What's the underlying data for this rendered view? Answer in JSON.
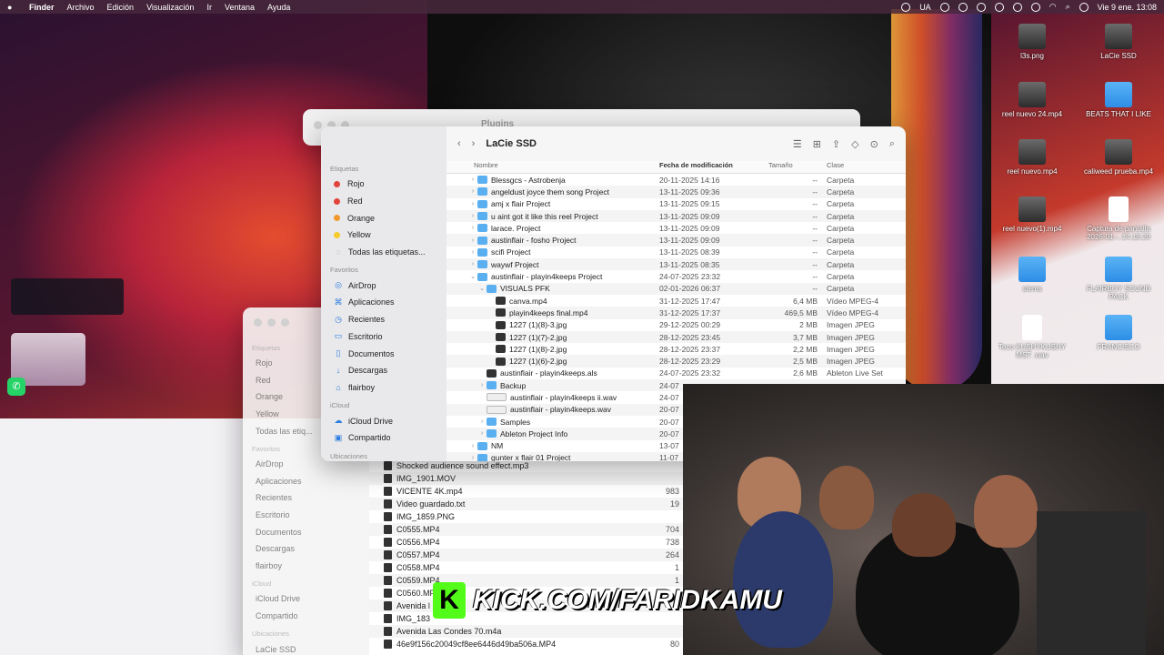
{
  "menubar": {
    "apple": "",
    "items": [
      "Finder",
      "Archivo",
      "Edición",
      "Visualización",
      "Ir",
      "Ventana",
      "Ayuda"
    ],
    "input_source": "UA",
    "datetime": "Vie 9 ene.  13:08"
  },
  "desktop_icons": [
    {
      "label": "l3s.png",
      "kind": "thumb"
    },
    {
      "label": "LaCie SSD",
      "kind": "drive"
    },
    {
      "label": "reel nuevo 24.mp4",
      "kind": "thumb"
    },
    {
      "label": "BEATS THAT I LIKE",
      "kind": "folder"
    },
    {
      "label": "reel nuevo.mp4",
      "kind": "thumb"
    },
    {
      "label": "caliweed prueba.mp4",
      "kind": "thumb"
    },
    {
      "label": "reel nuevo(1).mp4",
      "kind": "thumb"
    },
    {
      "label": "Captura de pantalla 2026-01-...14.18.20",
      "kind": "doc"
    },
    {
      "label": "stems",
      "kind": "folder"
    },
    {
      "label": "FLAIRBOY SOUND PACK",
      "kind": "folder"
    },
    {
      "label": "Teco KUSHYKUSHY MST .wav",
      "kind": "doc"
    },
    {
      "label": "FRANCISCO",
      "kind": "folder"
    }
  ],
  "back_window": {
    "title": "Plugins"
  },
  "finder": {
    "title": "LaCie SSD",
    "sidebar": {
      "tags_header": "Etiquetas",
      "tags": [
        {
          "label": "Rojo",
          "color": "#e0443a"
        },
        {
          "label": "Red",
          "color": "#e0443a"
        },
        {
          "label": "Orange",
          "color": "#f09a2e"
        },
        {
          "label": "Yellow",
          "color": "#f5cc29"
        }
      ],
      "all_tags": "Todas las etiquetas...",
      "favorites_header": "Favoritos",
      "favorites": [
        {
          "label": "AirDrop",
          "icon": "airdrop-icon",
          "glyph": "◎"
        },
        {
          "label": "Aplicaciones",
          "icon": "applications-icon",
          "glyph": "⌘"
        },
        {
          "label": "Recientes",
          "icon": "clock-icon",
          "glyph": "◷"
        },
        {
          "label": "Escritorio",
          "icon": "desktop-icon",
          "glyph": "▭"
        },
        {
          "label": "Documentos",
          "icon": "document-icon",
          "glyph": "▯"
        },
        {
          "label": "Descargas",
          "icon": "download-icon",
          "glyph": "↓"
        },
        {
          "label": "flairboy",
          "icon": "home-icon",
          "glyph": "⌂"
        }
      ],
      "icloud_header": "iCloud",
      "icloud": [
        {
          "label": "iCloud Drive",
          "icon": "cloud-icon",
          "glyph": "☁"
        },
        {
          "label": "Compartido",
          "icon": "shared-folder-icon",
          "glyph": "▣"
        }
      ],
      "locations_header": "Ubicaciones"
    },
    "columns": {
      "name": "Nombre",
      "date": "Fecha de modificación",
      "size": "Tamaño",
      "kind": "Clase"
    },
    "rows": [
      {
        "indent": 0,
        "chev": "›",
        "icon": "folder",
        "name": "Blessgcs - Astrobenja",
        "date": "20-11-2025 14:16",
        "size": "--",
        "kind": "Carpeta"
      },
      {
        "indent": 0,
        "chev": "›",
        "icon": "folder",
        "name": "angeldust joyce them song Project",
        "date": "13-11-2025 09:36",
        "size": "--",
        "kind": "Carpeta"
      },
      {
        "indent": 0,
        "chev": "›",
        "icon": "folder",
        "name": "amj x flair Project",
        "date": "13-11-2025 09:15",
        "size": "--",
        "kind": "Carpeta"
      },
      {
        "indent": 0,
        "chev": "›",
        "icon": "folder",
        "name": "u aint got it like this reel Project",
        "date": "13-11-2025 09:09",
        "size": "--",
        "kind": "Carpeta"
      },
      {
        "indent": 0,
        "chev": "›",
        "icon": "folder",
        "name": "larace. Project",
        "date": "13-11-2025 09:09",
        "size": "--",
        "kind": "Carpeta"
      },
      {
        "indent": 0,
        "chev": "›",
        "icon": "folder",
        "name": "austinflair - fosho Project",
        "date": "13-11-2025 09:09",
        "size": "--",
        "kind": "Carpeta"
      },
      {
        "indent": 0,
        "chev": "›",
        "icon": "folder",
        "name": "scifi Project",
        "date": "13-11-2025 08:39",
        "size": "--",
        "kind": "Carpeta"
      },
      {
        "indent": 0,
        "chev": "›",
        "icon": "folder",
        "name": "waywf Project",
        "date": "13-11-2025 08:35",
        "size": "--",
        "kind": "Carpeta"
      },
      {
        "indent": 0,
        "chev": "⌄",
        "icon": "folder",
        "name": "austinflair - playin4keeps Project",
        "date": "24-07-2025 23:32",
        "size": "--",
        "kind": "Carpeta"
      },
      {
        "indent": 1,
        "chev": "⌄",
        "icon": "folder",
        "name": "VISUALS PFK",
        "date": "02-01-2026 06:37",
        "size": "--",
        "kind": "Carpeta"
      },
      {
        "indent": 2,
        "chev": "",
        "icon": "file",
        "name": "canva.mp4",
        "date": "31-12-2025 17:47",
        "size": "6,4 MB",
        "kind": "Vídeo MPEG-4"
      },
      {
        "indent": 2,
        "chev": "",
        "icon": "file",
        "name": "playin4keeps final.mp4",
        "date": "31-12-2025 17:37",
        "size": "469,5 MB",
        "kind": "Vídeo MPEG-4"
      },
      {
        "indent": 2,
        "chev": "",
        "icon": "file",
        "name": "1227 (1)(8)-3.jpg",
        "date": "29-12-2025 00:29",
        "size": "2 MB",
        "kind": "Imagen JPEG"
      },
      {
        "indent": 2,
        "chev": "",
        "icon": "file",
        "name": "1227 (1)(7)-2.jpg",
        "date": "28-12-2025 23:45",
        "size": "3,7 MB",
        "kind": "Imagen JPEG"
      },
      {
        "indent": 2,
        "chev": "",
        "icon": "file",
        "name": "1227 (1)(8)-2.jpg",
        "date": "28-12-2025 23:37",
        "size": "2,2 MB",
        "kind": "Imagen JPEG"
      },
      {
        "indent": 2,
        "chev": "",
        "icon": "file",
        "name": "1227 (1)(6)-2.jpg",
        "date": "28-12-2025 23:29",
        "size": "2,5 MB",
        "kind": "Imagen JPEG"
      },
      {
        "indent": 1,
        "chev": "",
        "icon": "file",
        "name": "austinflair - playin4keeps.als",
        "date": "24-07-2025 23:32",
        "size": "2,6 MB",
        "kind": "Ableton Live Set"
      },
      {
        "indent": 1,
        "chev": "›",
        "icon": "folder",
        "name": "Backup",
        "date": "24-07",
        "size": "",
        "kind": ""
      },
      {
        "indent": 1,
        "chev": "",
        "icon": "doc",
        "name": "austinflair - playin4keeps ii.wav",
        "date": "24-07",
        "size": "",
        "kind": ""
      },
      {
        "indent": 1,
        "chev": "",
        "icon": "doc",
        "name": "austinflair - playin4keeps.wav",
        "date": "20-07",
        "size": "",
        "kind": ""
      },
      {
        "indent": 1,
        "chev": "›",
        "icon": "folder",
        "name": "Samples",
        "date": "20-07",
        "size": "",
        "kind": ""
      },
      {
        "indent": 1,
        "chev": "›",
        "icon": "folder",
        "name": "Ableton Project Info",
        "date": "20-07",
        "size": "",
        "kind": ""
      },
      {
        "indent": 0,
        "chev": "›",
        "icon": "folder",
        "name": "NM",
        "date": "13-07",
        "size": "",
        "kind": ""
      },
      {
        "indent": 0,
        "chev": "›",
        "icon": "folder",
        "name": "gunter x flair 01 Project",
        "date": "11-07",
        "size": "",
        "kind": ""
      }
    ]
  },
  "ghost_sidebar": {
    "tags_header": "Etiquetas",
    "tags": [
      "Rojo",
      "Red",
      "Orange",
      "Yellow",
      "Todas las etiq..."
    ],
    "favorites_header": "Favoritos",
    "favorites": [
      "AirDrop",
      "Aplicaciones",
      "Recientes",
      "Escritorio",
      "Documentos",
      "Descargas",
      "flairboy"
    ],
    "icloud_header": "iCloud",
    "icloud": [
      "iCloud Drive",
      "Compartido"
    ],
    "locations_header": "Ubicaciones",
    "locations": [
      "LaCie SSD"
    ]
  },
  "downloads_list": [
    {
      "name": "Shocked audience sound effect.mp3",
      "size": ""
    },
    {
      "name": "IMG_1901.MOV",
      "size": ""
    },
    {
      "name": "VICENTE 4K.mp4",
      "size": "983"
    },
    {
      "name": "Video guardado.txt",
      "size": "19"
    },
    {
      "name": "IMG_1859.PNG",
      "size": ""
    },
    {
      "name": "C0555.MP4",
      "size": "704"
    },
    {
      "name": "C0556.MP4",
      "size": "738"
    },
    {
      "name": "C0557.MP4",
      "size": "264"
    },
    {
      "name": "C0558.MP4",
      "size": "1"
    },
    {
      "name": "C0559.MP4",
      "size": "1"
    },
    {
      "name": "C0560.MP4",
      "size": ""
    },
    {
      "name": "Avenida l",
      "size": ""
    },
    {
      "name": "IMG_183",
      "size": ""
    },
    {
      "name": "Avenida Las Condes 70.m4a",
      "size": ""
    },
    {
      "name": "46e9f156c20049cf8ee6446d49ba506a.MP4",
      "size": "80"
    }
  ],
  "overlay": {
    "kick_logo": "K",
    "kick_text": "KICK.COM/FARIDKAMU"
  }
}
